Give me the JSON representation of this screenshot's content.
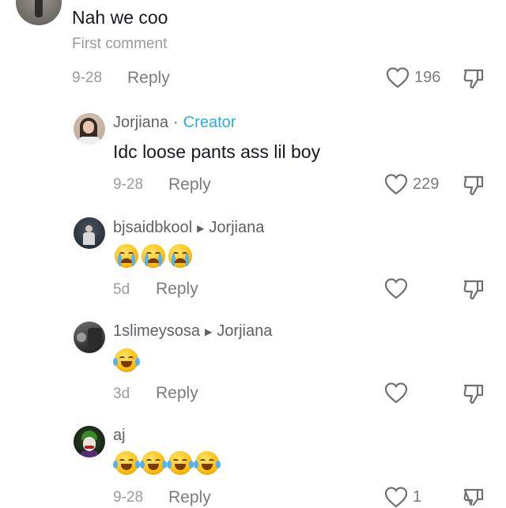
{
  "comments": [
    {
      "text": "Nah we coo",
      "subtext": "First comment",
      "date": "9-28",
      "reply_label": "Reply",
      "likes": "196"
    },
    {
      "username": "Jorjiana",
      "separator": "·",
      "badge": "Creator",
      "text": "Idc loose pants ass lil boy",
      "date": "9-28",
      "reply_label": "Reply",
      "likes": "229"
    },
    {
      "username": "bjsaidbkool",
      "reply_to": "Jorjiana",
      "emojis": [
        "loudly-crying-face",
        "loudly-crying-face",
        "loudly-crying-face"
      ],
      "date": "5d",
      "reply_label": "Reply",
      "likes": ""
    },
    {
      "username": "1slimeysosa",
      "reply_to": "Jorjiana",
      "emojis": [
        "face-with-tears-of-joy"
      ],
      "date": "3d",
      "reply_label": "Reply",
      "likes": ""
    },
    {
      "username": "aj",
      "emojis": [
        "face-with-tears-of-joy",
        "face-with-tears-of-joy",
        "face-with-tears-of-joy",
        "face-with-tears-of-joy"
      ],
      "date": "9-28",
      "reply_label": "Reply",
      "likes": "1"
    }
  ],
  "icons": {
    "like": "heart-icon",
    "dislike": "thumbs-down-icon",
    "reply_arrow": "triangle-right-icon"
  },
  "colors": {
    "creator_badge": "#2ab0d6",
    "text": "#161823",
    "secondary": "#9a9ba1"
  }
}
